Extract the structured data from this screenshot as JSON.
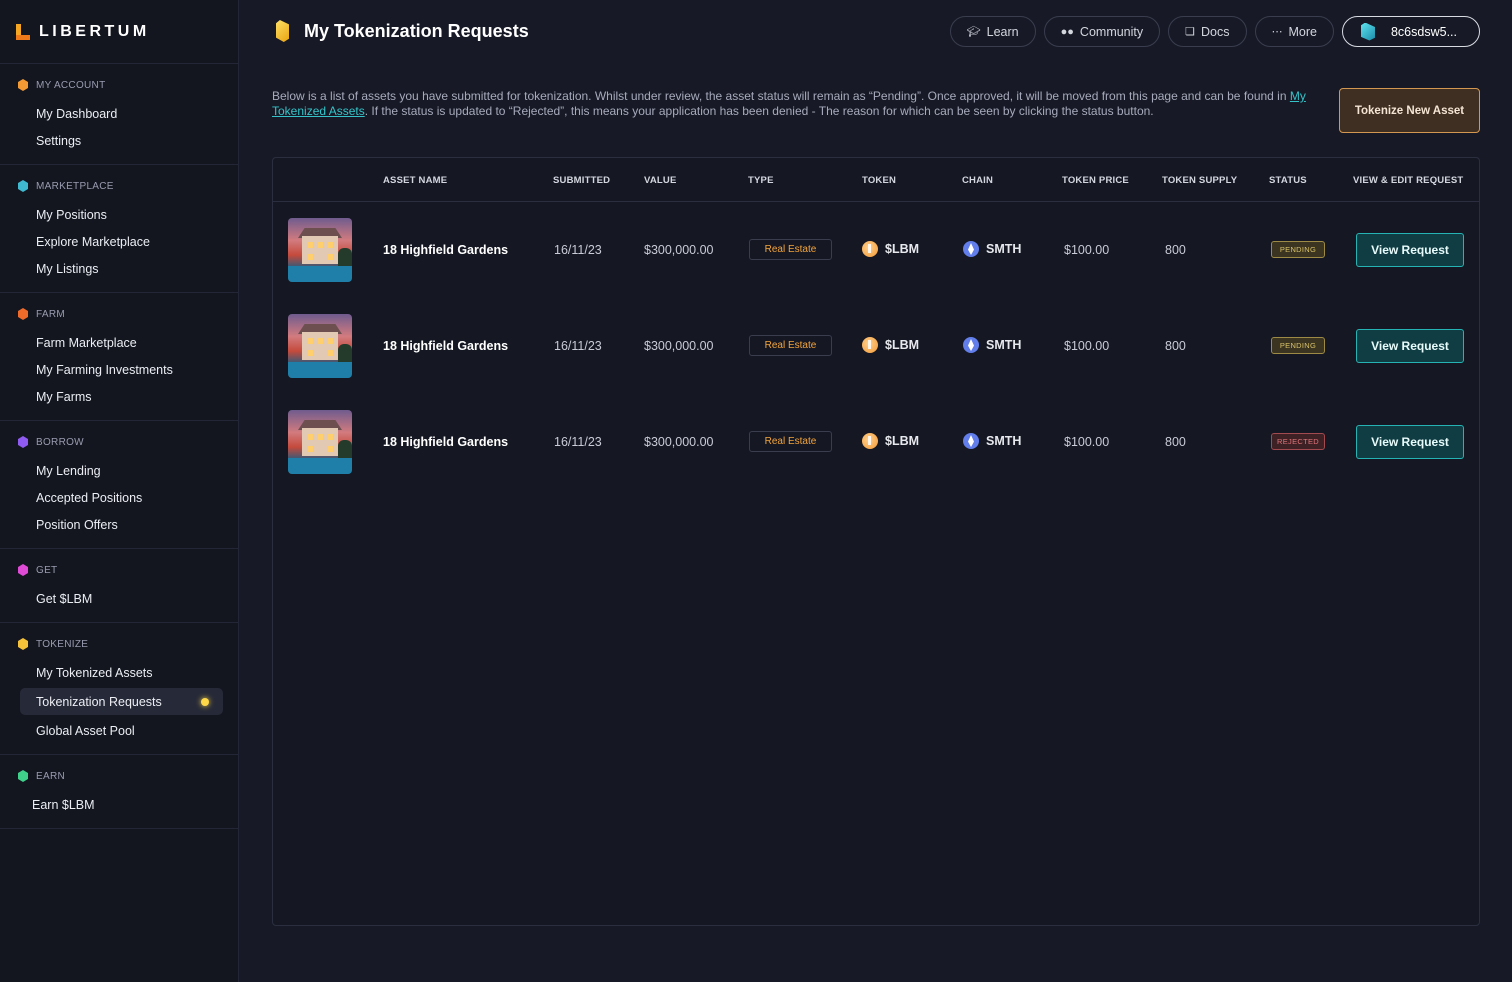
{
  "app": {
    "logo_text": "LIBERTUM"
  },
  "sidebar": {
    "sections": [
      {
        "label": "MY ACCOUNT",
        "color": "#f39a35",
        "items": [
          "My Dashboard",
          "Settings"
        ]
      },
      {
        "label": "MARKETPLACE",
        "color": "#3fb9d0",
        "items": [
          "My Positions",
          "Explore Marketplace",
          "My Listings"
        ]
      },
      {
        "label": "FARM",
        "color": "#f06a2a",
        "items": [
          "Farm Marketplace",
          "My Farming Investments",
          "My Farms"
        ]
      },
      {
        "label": "BORROW",
        "color": "#8f5bf0",
        "items": [
          "My Lending",
          "Accepted Positions",
          "Position Offers"
        ]
      },
      {
        "label": "GET",
        "color": "#e04bd6",
        "items": [
          "Get $LBM"
        ]
      },
      {
        "label": "TOKENIZE",
        "color": "#f5c23a",
        "items": [
          "My Tokenized Assets",
          "Tokenization Requests",
          "Global Asset Pool"
        ]
      },
      {
        "label": "EARN",
        "color": "#3fd08a",
        "items": [
          "Earn $LBM"
        ]
      }
    ],
    "active_item": "Tokenization Requests"
  },
  "header": {
    "title": "My Tokenization Requests",
    "nav": [
      {
        "label": "Learn",
        "icon": "graduation-cap-icon"
      },
      {
        "label": "Community",
        "icon": "users-icon"
      },
      {
        "label": "Docs",
        "icon": "docs-icon"
      },
      {
        "label": "More",
        "icon": "more-icon"
      }
    ],
    "wallet": "8c6sdsw5..."
  },
  "intro": {
    "text_before": "Below is a list of assets you have submitted for tokenization. Whilst under review, the asset status will remain as “Pending”. Once approved, it will be moved from this page and can be found in ",
    "link": "My Tokenized Assets",
    "text_after": ". If the status is updated to “Rejected”, this means your application has been denied - The reason for which can be seen by clicking the status button."
  },
  "actions": {
    "tokenize_new": "Tokenize New Asset"
  },
  "table": {
    "headers": {
      "asset_name": "ASSET NAME",
      "submitted": "SUBMITTED",
      "value": "VALUE",
      "type": "TYPE",
      "token": "TOKEN",
      "chain": "CHAIN",
      "token_price": "TOKEN PRICE",
      "token_supply": "TOKEN SUPPLY",
      "status": "STATUS",
      "view_edit": "VIEW & EDIT REQUEST"
    },
    "rows": [
      {
        "name": "18 Highfield Gardens",
        "submitted": "16/11/23",
        "value": "$300,000.00",
        "type": "Real Estate",
        "token": "$LBM",
        "chain": "SMTH",
        "token_price": "$100.00",
        "token_supply": "800",
        "status": "PENDING",
        "action": "View Request"
      },
      {
        "name": "18 Highfield Gardens",
        "submitted": "16/11/23",
        "value": "$300,000.00",
        "type": "Real Estate",
        "token": "$LBM",
        "chain": "SMTH",
        "token_price": "$100.00",
        "token_supply": "800",
        "status": "PENDING",
        "action": "View Request"
      },
      {
        "name": "18 Highfield Gardens",
        "submitted": "16/11/23",
        "value": "$300,000.00",
        "type": "Real Estate",
        "token": "$LBM",
        "chain": "SMTH",
        "token_price": "$100.00",
        "token_supply": "800",
        "status": "REJECTED",
        "action": "View Request"
      }
    ]
  }
}
